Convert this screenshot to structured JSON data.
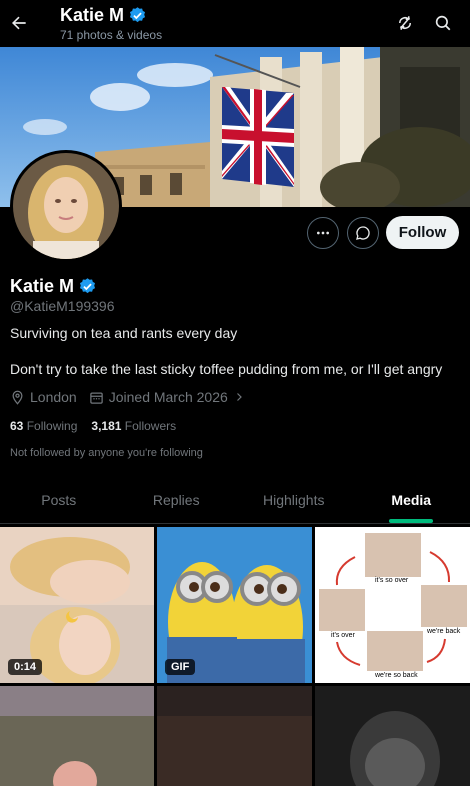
{
  "header": {
    "back_icon": "arrow-left-icon",
    "name": "Katie M",
    "subtitle": "71 photos & videos",
    "verified_icon": "verified-badge-icon",
    "actions": [
      "refresh-icon",
      "search-icon"
    ]
  },
  "profile": {
    "name": "Katie M",
    "handle": "@KatieM199396",
    "bio_line1": "Surviving on tea and rants every day",
    "bio_line2": "Don't try to take the last sticky toffee pudding from me, or I'll get angry",
    "location": "London",
    "joined": "Joined March 2026",
    "following_count": "63",
    "following_label": "Following",
    "followers_count": "3,181",
    "followers_label": "Followers",
    "not_followed_text": "Not followed by anyone you're following"
  },
  "actions": {
    "more_icon": "more-icon",
    "message_icon": "message-icon",
    "follow_label": "Follow"
  },
  "tabs": [
    {
      "label": "Posts",
      "active": false
    },
    {
      "label": "Replies",
      "active": false
    },
    {
      "label": "Highlights",
      "active": false
    },
    {
      "label": "Media",
      "active": true
    }
  ],
  "media": [
    {
      "badge": "0:14"
    },
    {
      "badge": "GIF"
    },
    {
      "badge": "",
      "texts": [
        "it's so over",
        "it's over",
        "we're back",
        "we're so back"
      ]
    },
    {
      "badge": ""
    },
    {
      "badge": ""
    },
    {
      "badge": ""
    }
  ],
  "colors": {
    "accent": "#1d9bf0",
    "active_tab_indicator": "#00ba7c",
    "background": "#000000",
    "muted": "#71767b"
  }
}
